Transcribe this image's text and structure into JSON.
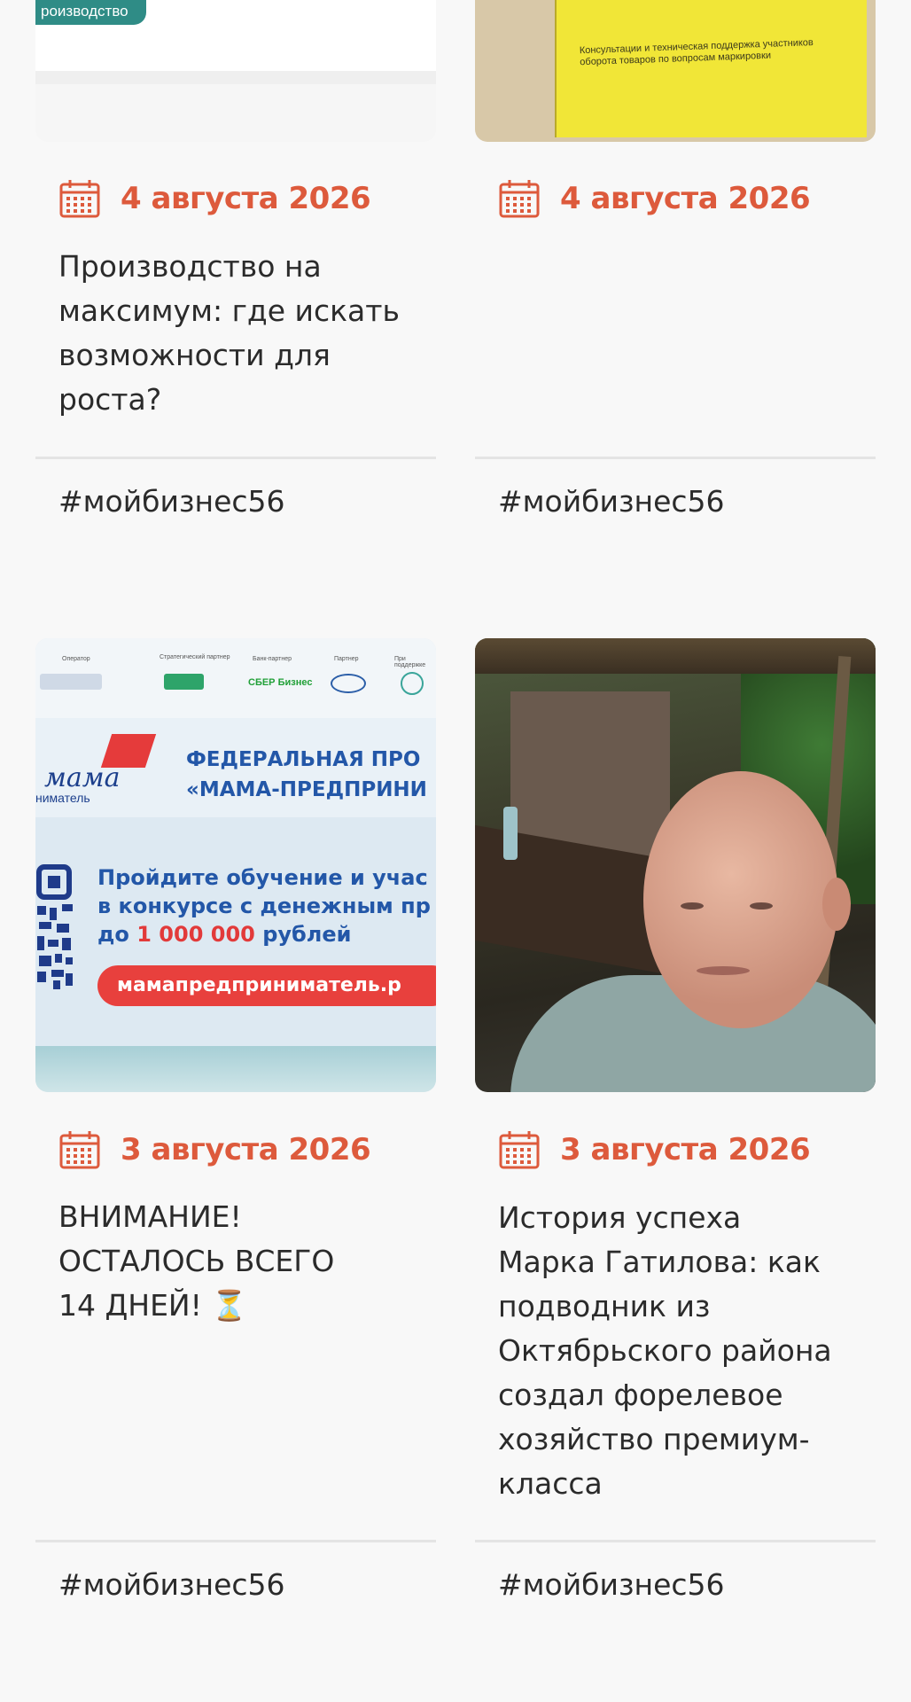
{
  "cards": [
    {
      "badge": "роизводство",
      "date": "4 августа 2026",
      "title_lines": [
        "Производство на",
        "максимум: где искать",
        "возможности для",
        "роста?"
      ],
      "tag": "#мойбизнес56"
    },
    {
      "image_text": "Консультации и техническая поддержка участников оборота товаров по вопросам маркировки",
      "date": "4 августа 2026",
      "tag": "#мойбизнес56"
    },
    {
      "banner": {
        "logos": [
          "Оператор",
          "Стратегический партнер",
          "Банк-партнер",
          "Партнер",
          "При поддержке"
        ],
        "brand": "мама",
        "brand_sub": "ниматель",
        "heading_1": "ФЕДЕРАЛЬНАЯ ПРО",
        "heading_2": "«МАМА-ПРЕДПРИНИ",
        "body_1": "Пройдите обучение и учас",
        "body_2": "в конкурсе с денежным пр",
        "body_3_prefix": "до ",
        "body_3_amount": "1 000 000",
        "body_3_suffix": " рублей",
        "site": "мамапредприниматель.р",
        "sber": "СБЕР Бизнес"
      },
      "date": "3 августа 2026",
      "title_lines": [
        "ВНИМАНИЕ!",
        "ОСТАЛОСЬ ВСЕГО",
        "14 ДНЕЙ! ⏳"
      ],
      "tag": "#мойбизнес56"
    },
    {
      "date": "3 августа 2026",
      "title_lines": [
        "История успеха",
        "Марка Гатилова: как",
        "подводник из",
        "Октябрьского района",
        "создал форелевое",
        "хозяйство премиум-",
        "класса"
      ],
      "tag": "#мойбизнес56"
    }
  ],
  "icons": {
    "date": "calendar-icon",
    "timer": "hourglass-icon"
  },
  "colors": {
    "accent": "#dd5a3c",
    "text": "#2b2b2b",
    "badge": "#2f8c86",
    "divider": "#e4e4e4"
  }
}
